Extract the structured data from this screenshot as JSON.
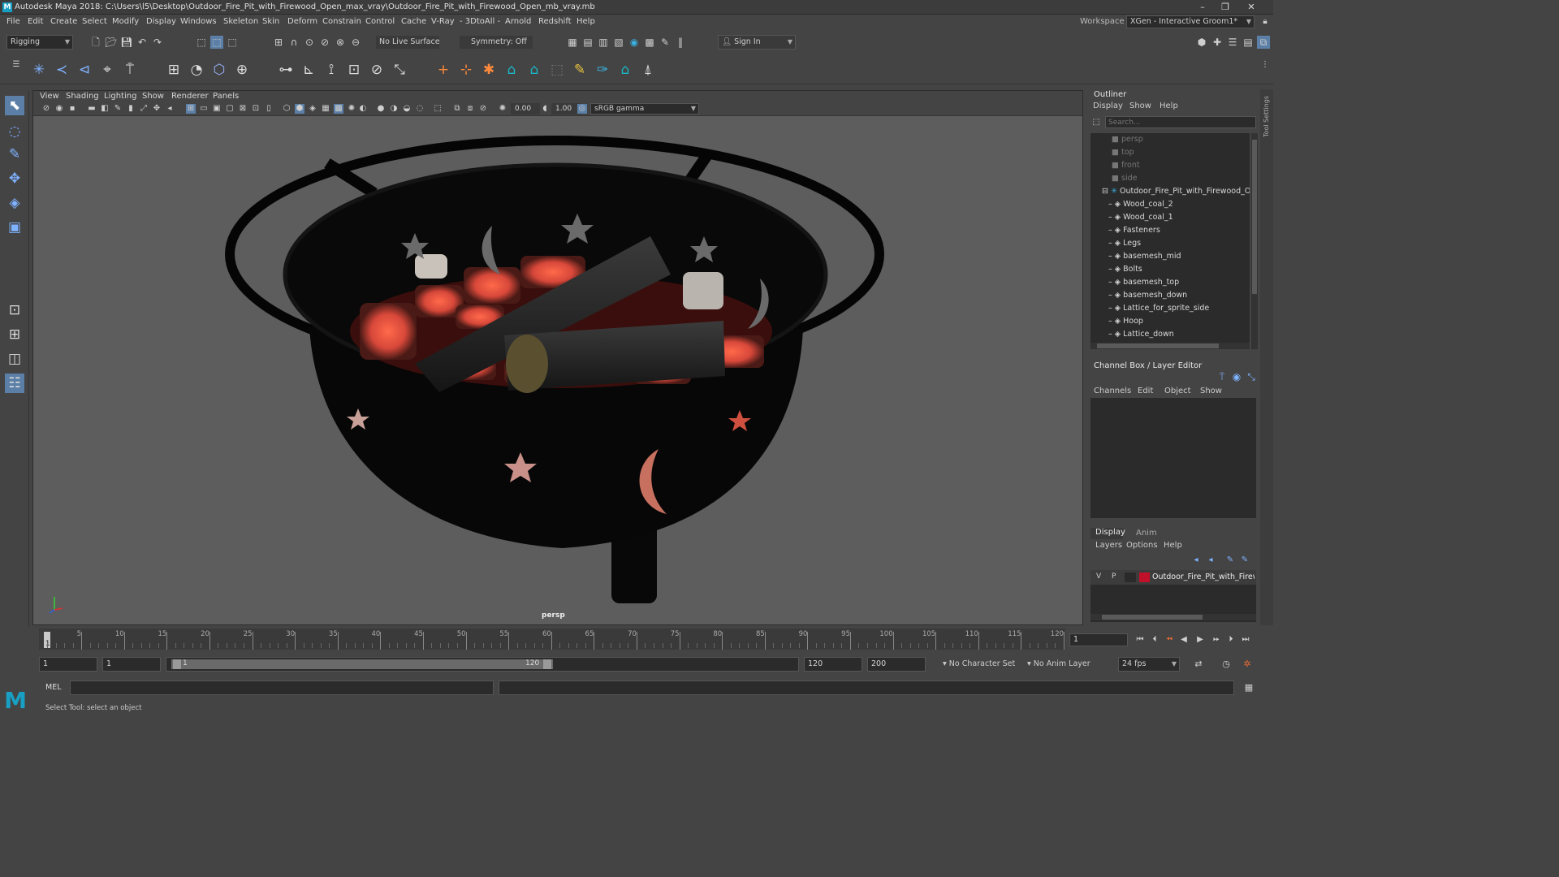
{
  "window": {
    "title": "Autodesk Maya 2018: C:\\Users\\l5\\Desktop\\Outdoor_Fire_Pit_with_Firewood_Open_max_vray\\Outdoor_Fire_Pit_with_Firewood_Open_mb_vray.mb",
    "workspace_label": "Workspace :",
    "workspace_value": "XGen - Interactive Groom1*"
  },
  "menubar": [
    "File",
    "Edit",
    "Create",
    "Select",
    "Modify",
    "Display",
    "Windows",
    "Skeleton",
    "Skin",
    "Deform",
    "Constrain",
    "Control",
    "Cache",
    "V-Ray",
    "- 3DtoAll -",
    "Arnold",
    "Redshift",
    "Help"
  ],
  "shelf": {
    "mode": "Rigging",
    "live_surface": "No Live Surface",
    "symmetry": "Symmetry: Off",
    "sign_in": "Sign In"
  },
  "viewport": {
    "menu": [
      "View",
      "Shading",
      "Lighting",
      "Show",
      "Renderer",
      "Panels"
    ],
    "exposure": "0.00",
    "gamma": "1.00",
    "color_space": "sRGB gamma",
    "camera_label": "persp"
  },
  "outliner": {
    "title": "Outliner",
    "menu": [
      "Display",
      "Show",
      "Help"
    ],
    "search_placeholder": "Search...",
    "cameras": [
      "persp",
      "top",
      "front",
      "side"
    ],
    "group": "Outdoor_Fire_Pit_with_Firewood_Op",
    "children": [
      "Wood_coal_2",
      "Wood_coal_1",
      "Fasteners",
      "Legs",
      "basemesh_mid",
      "Bolts",
      "basemesh_top",
      "basemesh_down",
      "Lattice_for_sprite_side",
      "Hoop",
      "Lattice_down"
    ]
  },
  "channelbox": {
    "title": "Channel Box / Layer Editor",
    "menu": [
      "Channels",
      "Edit",
      "Object",
      "Show"
    ]
  },
  "layers": {
    "tabs": [
      "Display",
      "Anim"
    ],
    "menu": [
      "Layers",
      "Options",
      "Help"
    ],
    "layer_v": "V",
    "layer_p": "P",
    "layer_name": "Outdoor_Fire_Pit_with_Firewo",
    "layer_color": "#c0102a"
  },
  "timeline": {
    "ticks": [
      "5",
      "10",
      "15",
      "20",
      "25",
      "30",
      "35",
      "40",
      "45",
      "50",
      "55",
      "60",
      "65",
      "70",
      "75",
      "80",
      "85",
      "90",
      "95",
      "100",
      "105",
      "110",
      "115",
      "120"
    ],
    "start_marker": "1",
    "current_frame": "1"
  },
  "range": {
    "start": "1",
    "playback_start": "1",
    "slider_start": "1",
    "slider_end": "120",
    "playback_end": "120",
    "end": "200",
    "character_set": "No Character Set",
    "anim_layer": "No Anim Layer",
    "fps": "24 fps"
  },
  "command": {
    "label": "MEL"
  },
  "help": {
    "text": "Select Tool: select an object"
  }
}
